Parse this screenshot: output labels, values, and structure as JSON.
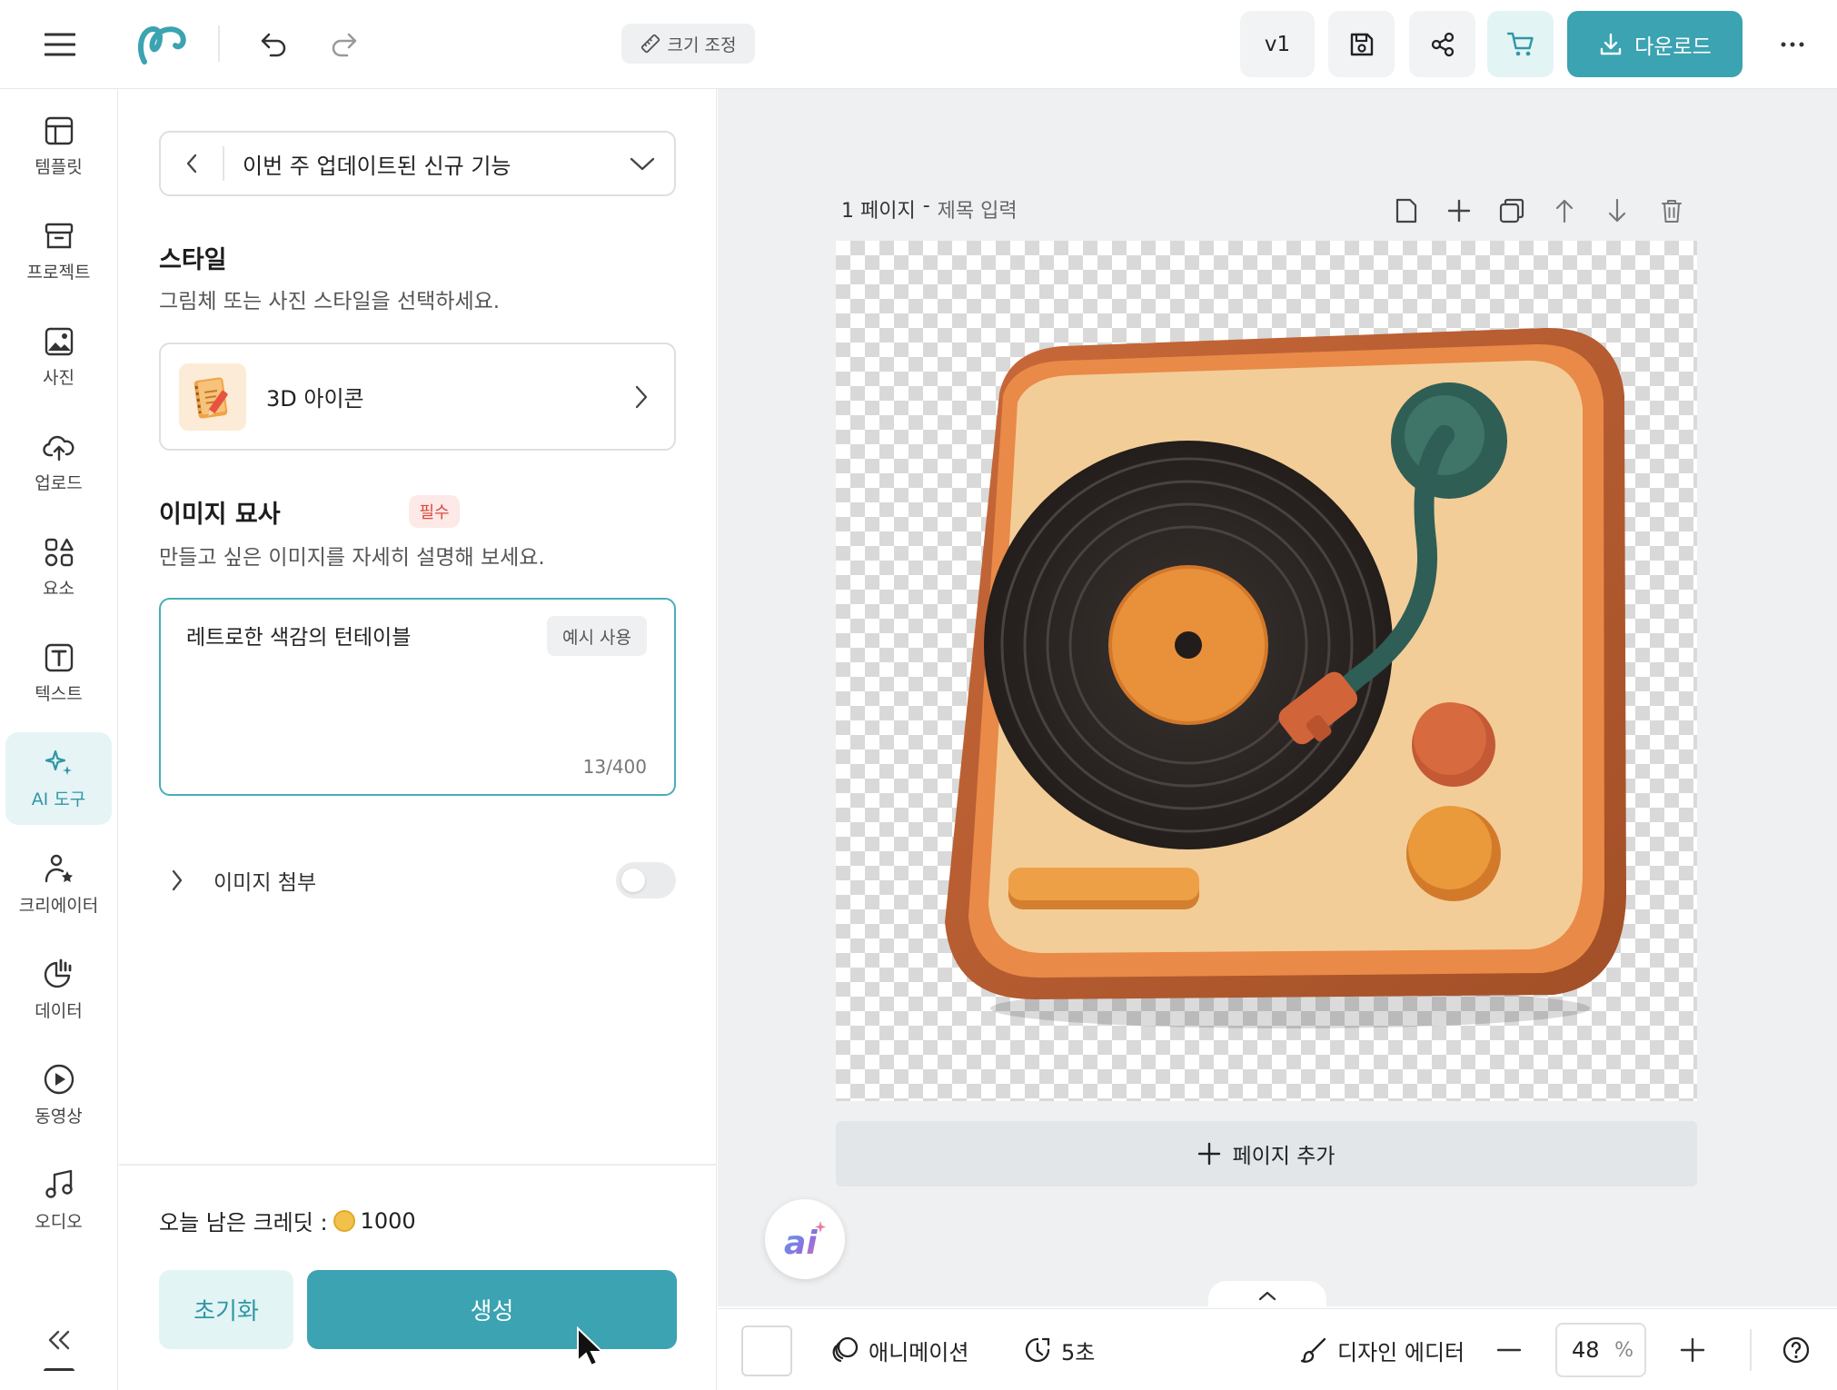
{
  "topbar": {
    "resize_label": "크기 조정",
    "version_label": "v1",
    "download_label": "다운로드"
  },
  "nav": {
    "items": [
      {
        "label": "템플릿",
        "icon": "template-icon"
      },
      {
        "label": "프로젝트",
        "icon": "project-icon"
      },
      {
        "label": "사진",
        "icon": "photo-icon"
      },
      {
        "label": "업로드",
        "icon": "upload-icon"
      },
      {
        "label": "요소",
        "icon": "elements-icon"
      },
      {
        "label": "텍스트",
        "icon": "text-icon"
      },
      {
        "label": "AI 도구",
        "icon": "ai-sparkle-icon",
        "active": true
      },
      {
        "label": "크리에이터",
        "icon": "creator-icon"
      },
      {
        "label": "데이터",
        "icon": "data-chart-icon"
      },
      {
        "label": "동영상",
        "icon": "video-icon"
      },
      {
        "label": "오디오",
        "icon": "audio-icon"
      }
    ]
  },
  "panel": {
    "feature_label": "이번 주 업데이트된 신규 기능",
    "style": {
      "title": "스타일",
      "description": "그림체 또는 사진 스타일을 선택하세요.",
      "selected": "3D 아이콘"
    },
    "prompt": {
      "title": "이미지 묘사",
      "required_badge": "필수",
      "description": "만들고 싶은 이미지를 자세히 설명해 보세요.",
      "value": "레트로한 색감의 턴테이블",
      "example_button": "예시 사용",
      "char_count": "13/400"
    },
    "attach": {
      "label": "이미지 첨부",
      "enabled": false
    },
    "credits": {
      "label": "오늘 남은 크레딧 :",
      "value": "1000"
    },
    "reset_label": "초기화",
    "generate_label": "생성"
  },
  "canvas": {
    "page_number": "1 페이지",
    "separator": "-",
    "page_title_placeholder": "제목 입력",
    "add_page_label": "페이지 추가",
    "ai_fab_label": "ai"
  },
  "bottombar": {
    "animation_label": "애니메이션",
    "duration_label": "5초",
    "design_editor_label": "디자인 에디터",
    "zoom_value": "48",
    "zoom_unit": "%"
  },
  "colors": {
    "accent": "#3ba3b1",
    "accent_light": "#e3f4f5",
    "required": "#d94a3d"
  }
}
